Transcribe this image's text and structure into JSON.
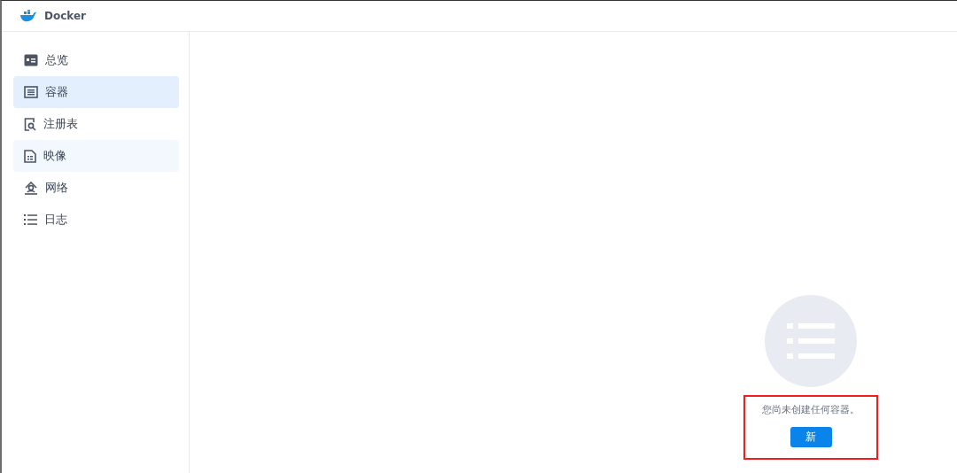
{
  "window": {
    "title": "Docker"
  },
  "sidebar": {
    "items": [
      {
        "label": "总览",
        "kind": "overview",
        "selected": false,
        "hovered": false
      },
      {
        "label": "容器",
        "kind": "container",
        "selected": true,
        "hovered": false
      },
      {
        "label": "注册表",
        "kind": "registry",
        "selected": false,
        "hovered": false
      },
      {
        "label": "映像",
        "kind": "image",
        "selected": false,
        "hovered": true
      },
      {
        "label": "网络",
        "kind": "network",
        "selected": false,
        "hovered": false
      },
      {
        "label": "日志",
        "kind": "log",
        "selected": false,
        "hovered": false
      }
    ]
  },
  "empty_state": {
    "message": "您尚未创建任何容器。",
    "button": "新",
    "highlighted": true
  }
}
